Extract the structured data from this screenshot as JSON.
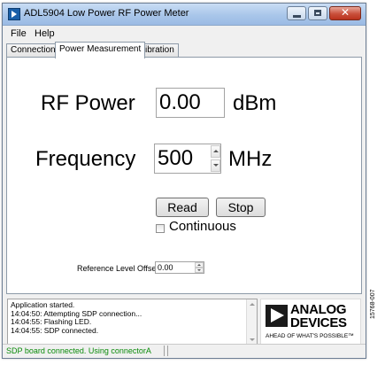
{
  "window": {
    "title": "ADL5904 Low Power RF Power Meter",
    "buttons": {
      "minimize": "—",
      "maximize": "□",
      "close": "✕"
    }
  },
  "menu": [
    "File",
    "Help"
  ],
  "tabs": [
    {
      "label": "Connection",
      "active": false
    },
    {
      "label": "Power Measurement",
      "active": true
    },
    {
      "label": "Calibration",
      "active": false
    }
  ],
  "rf_power": {
    "label": "RF Power",
    "value": "0.00",
    "unit": "dBm"
  },
  "frequency": {
    "label": "Frequency",
    "value": "500",
    "unit": "MHz"
  },
  "read_button": "Read",
  "stop_button": "Stop",
  "continuous": {
    "label": "Continuous",
    "checked": false
  },
  "reference_offset": {
    "label": "Reference Level Offset",
    "value": "0.00"
  },
  "log": [
    "Application started.",
    "14:04:50: Attempting SDP connection...",
    "14:04:55: Flashing LED.",
    "14:04:55: SDP connected."
  ],
  "logo": {
    "line1": "ANALOG",
    "line2": "DEVICES",
    "tagline": "AHEAD OF WHAT'S POSSIBLE™"
  },
  "status": {
    "text": "SDP board connected. Using connectorA",
    "color": "#0a8a0a"
  },
  "figure_id": "15768-007"
}
